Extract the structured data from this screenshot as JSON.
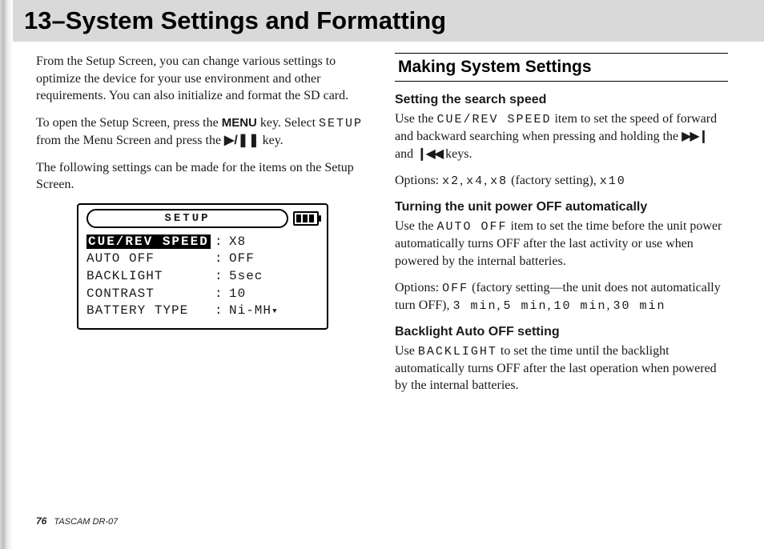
{
  "chapter": {
    "title": "13–System Settings and Formatting"
  },
  "left": {
    "p1": "From the Setup Screen, you can change various settings to optimize the device for your use envi­ronment and other requirements. You can also initialize and format the SD card.",
    "p2a": "To open the Setup Screen, press the ",
    "menu_key": "MENU",
    "p2b": " key. Select ",
    "setup_code": "SETUP",
    "p2c": " from the Menu Screen and press the ",
    "playpause": "▶/❚❚",
    "p2d": " key.",
    "p3": "The following settings can be made for the items on the Setup Screen."
  },
  "lcd": {
    "title": "SETUP",
    "rows": [
      {
        "label": "CUE/REV SPEED",
        "value": "X8",
        "selected": true
      },
      {
        "label": "AUTO OFF",
        "value": "OFF"
      },
      {
        "label": "BACKLIGHT",
        "value": " 5sec"
      },
      {
        "label": "CONTRAST",
        "value": "10"
      },
      {
        "label": "BATTERY TYPE",
        "value": "Ni-MH",
        "arrow": true
      }
    ]
  },
  "right": {
    "section_title": "Making System Settings",
    "s1": {
      "head": "Setting the search speed",
      "a": "Use the ",
      "code": "CUE/REV SPEED",
      "b": " item to set the speed of forward and backward searching when pressing and holding the ",
      "ff": "▶▶❙",
      "mid": " and ",
      "rw": "❙◀◀",
      "c": " keys.",
      "opts_a": "Options: ",
      "opt1": "x2",
      "sep": ", ",
      "opt2": "x4",
      "opt3": "x8",
      "factory": " (factory setting), ",
      "opt4": "x10"
    },
    "s2": {
      "head": "Turning the unit power OFF automatically",
      "a": "Use the ",
      "code": "AUTO OFF",
      "b": " item to set the time before the unit power automatically turns OFF after the last activity or use when powered by the internal batteries.",
      "opts_a": "Options: ",
      "off": "OFF",
      "factory": " (factory setting—the unit does not automatically turn OFF), ",
      "o1": "3 min",
      "o2": "5 min",
      "o3": "10 min",
      "o4": "30 min",
      "sep": ", "
    },
    "s3": {
      "head": "Backlight Auto OFF setting",
      "a": "Use ",
      "code": "BACKLIGHT",
      "b": " to set the time until the backlight automatically turns OFF after the last operation when powered by the internal batteries."
    }
  },
  "footer": {
    "page": "76",
    "model": "TASCAM  DR-07"
  }
}
